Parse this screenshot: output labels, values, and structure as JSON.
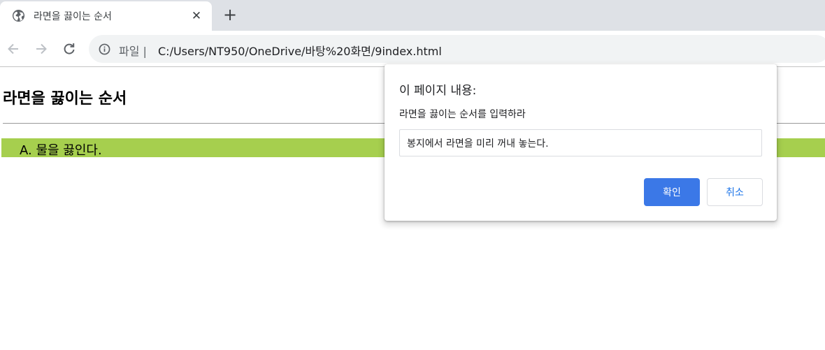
{
  "browser": {
    "tab": {
      "title": "라면을 끓이는 순서",
      "favicon": "globe-icon",
      "close_glyph": "✕"
    },
    "new_tab_glyph": "+",
    "omnibox": {
      "scheme_label": "파일 |",
      "url": "C:/Users/NT950/OneDrive/바탕%20화면/9index.html"
    }
  },
  "page": {
    "title": "라면을 끓이는 순서",
    "steps": [
      {
        "text": "A. 물을 끓인다."
      }
    ],
    "step_color": "#a6cf4e"
  },
  "dialog": {
    "title": "이 페이지 내용:",
    "message": "라면을 끓이는 순서를 입력하라",
    "input_value": "봉지에서 라면을 미리 꺼내 놓는다.",
    "ok_label": "확인",
    "cancel_label": "취소",
    "ok_color": "#3b78e7"
  }
}
